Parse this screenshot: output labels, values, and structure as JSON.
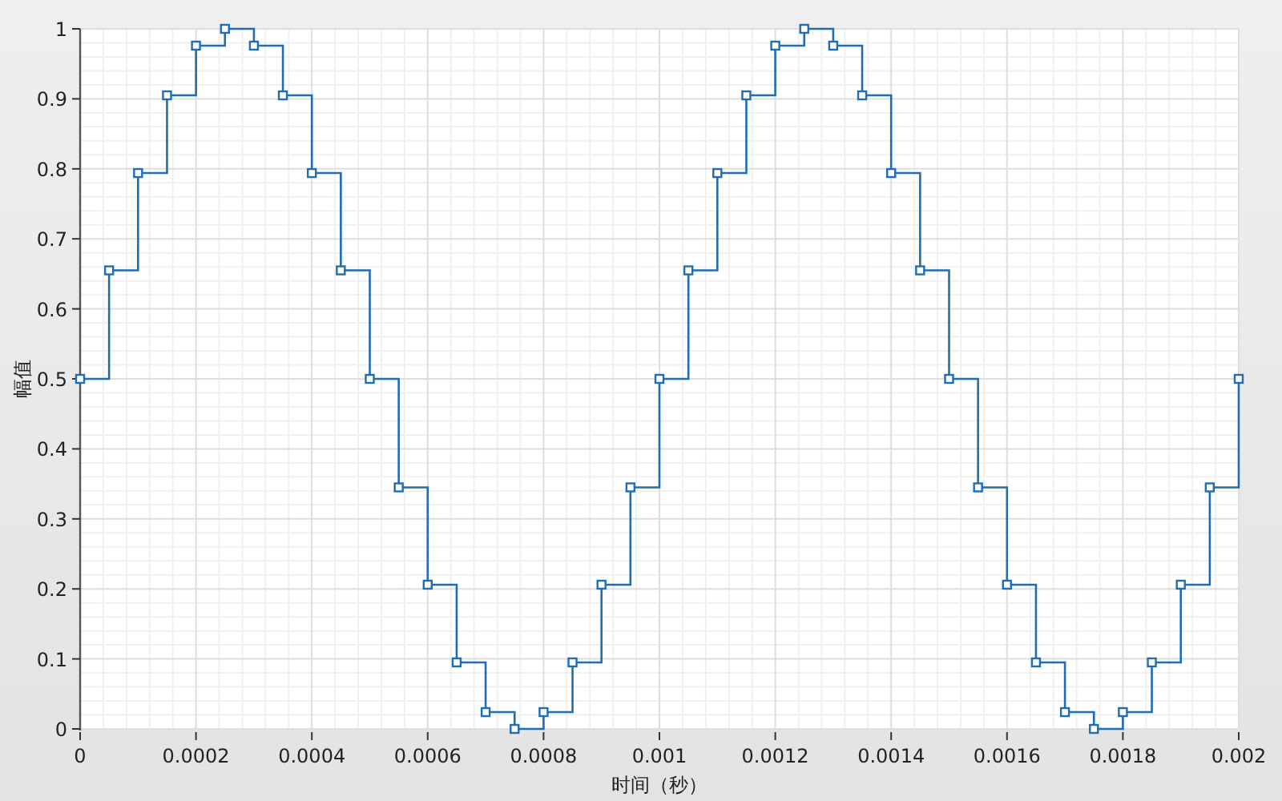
{
  "chart_data": {
    "type": "line",
    "xlabel": "时间（秒）",
    "ylabel": "幅值",
    "x": [
      0,
      5e-05,
      5e-05,
      0.0001,
      0.0001,
      0.00015,
      0.00015,
      0.0002,
      0.0002,
      0.00025,
      0.00025,
      0.0003,
      0.0003,
      0.00035,
      0.00035,
      0.0004,
      0.0004,
      0.00045,
      0.00045,
      0.0005,
      0.0005,
      0.00055,
      0.00055,
      0.0006,
      0.0006,
      0.00065,
      0.00065,
      0.0007,
      0.0007,
      0.00075,
      0.00075,
      0.0008,
      0.0008,
      0.00085,
      0.00085,
      0.0009,
      0.0009,
      0.00095,
      0.00095,
      0.001,
      0.001,
      0.00105,
      0.00105,
      0.0011,
      0.0011,
      0.00115,
      0.00115,
      0.0012,
      0.0012,
      0.00125,
      0.00125,
      0.0013,
      0.0013,
      0.00135,
      0.00135,
      0.0014,
      0.0014,
      0.00145,
      0.00145,
      0.0015,
      0.0015,
      0.00155,
      0.00155,
      0.0016,
      0.0016,
      0.00165,
      0.00165,
      0.0017,
      0.0017,
      0.00175,
      0.00175,
      0.0018,
      0.0018,
      0.00185,
      0.00185,
      0.0019,
      0.0019,
      0.00195,
      0.00195,
      0.002,
      0.002
    ],
    "series": [
      {
        "color": "#1f6db3",
        "marker": "square",
        "values": [
          0.5,
          0.5,
          0.655,
          0.655,
          0.794,
          0.794,
          0.905,
          0.905,
          0.976,
          0.976,
          1,
          1,
          0.976,
          0.976,
          0.905,
          0.905,
          0.794,
          0.794,
          0.655,
          0.655,
          0.5,
          0.5,
          0.345,
          0.345,
          0.206,
          0.206,
          0.095,
          0.095,
          0.024,
          0.024,
          0,
          0,
          0.024,
          0.024,
          0.095,
          0.095,
          0.206,
          0.206,
          0.345,
          0.345,
          0.5,
          0.5,
          0.655,
          0.655,
          0.794,
          0.794,
          0.905,
          0.905,
          0.976,
          0.976,
          1,
          1,
          0.976,
          0.976,
          0.905,
          0.905,
          0.794,
          0.794,
          0.655,
          0.655,
          0.5,
          0.5,
          0.345,
          0.345,
          0.206,
          0.206,
          0.095,
          0.095,
          0.024,
          0.024,
          0,
          0,
          0.024,
          0.024,
          0.095,
          0.095,
          0.206,
          0.206,
          0.345,
          0.345,
          0.5
        ]
      }
    ],
    "xlim": [
      0,
      0.002
    ],
    "ylim": [
      0,
      1
    ],
    "xticks": [
      {
        "value": 0,
        "label": "0"
      },
      {
        "value": 0.0002,
        "label": "0.0002"
      },
      {
        "value": 0.0004,
        "label": "0.0004"
      },
      {
        "value": 0.0006,
        "label": "0.0006"
      },
      {
        "value": 0.0008,
        "label": "0.0008"
      },
      {
        "value": 0.001,
        "label": "0.001"
      },
      {
        "value": 0.0012,
        "label": "0.0012"
      },
      {
        "value": 0.0014,
        "label": "0.0014"
      },
      {
        "value": 0.0016,
        "label": "0.0016"
      },
      {
        "value": 0.0018,
        "label": "0.0018"
      },
      {
        "value": 0.002,
        "label": "0.002"
      }
    ],
    "yticks": [
      {
        "value": 0,
        "label": "0"
      },
      {
        "value": 0.1,
        "label": "0.1"
      },
      {
        "value": 0.2,
        "label": "0.2"
      },
      {
        "value": 0.3,
        "label": "0.3"
      },
      {
        "value": 0.4,
        "label": "0.4"
      },
      {
        "value": 0.5,
        "label": "0.5"
      },
      {
        "value": 0.6,
        "label": "0.6"
      },
      {
        "value": 0.7,
        "label": "0.7"
      },
      {
        "value": 0.8,
        "label": "0.8"
      },
      {
        "value": 0.9,
        "label": "0.9"
      },
      {
        "value": 1,
        "label": "1"
      }
    ],
    "grid": true
  }
}
